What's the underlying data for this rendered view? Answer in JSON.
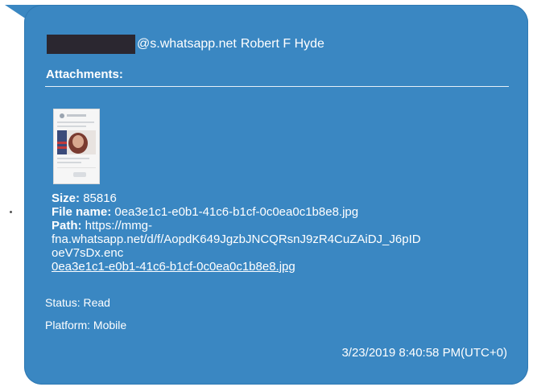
{
  "message": {
    "sender_domain": "@s.whatsapp.net",
    "sender_name": "Robert F Hyde",
    "attachments_label": "Attachments:",
    "attachment": {
      "size_label": "Size:",
      "size_value": "85816",
      "filename_label": "File name:",
      "filename_value": "0ea3e1c1-e0b1-41c6-b1cf-0c0ea0c1b8e8.jpg",
      "path_label": "Path:",
      "path_line1": "https://mmg-",
      "path_line2": "fna.whatsapp.net/d/f/AopdK649JgzbJNCQRsnJ9zR4CuZAiDJ_J6pID",
      "path_line3": "oeV7sDx.enc",
      "link_text": "0ea3e1c1-e0b1-41c6-b1cf-0c0ea0c1b8e8.jpg"
    },
    "status_label": "Status:",
    "status_value": "Read",
    "platform_label": "Platform:",
    "platform_value": "Mobile",
    "timestamp": "3/23/2019 8:40:58 PM(UTC+0)"
  },
  "colors": {
    "bubble": "#3a87c2",
    "redaction": "#2b2730",
    "text": "#ffffff"
  }
}
